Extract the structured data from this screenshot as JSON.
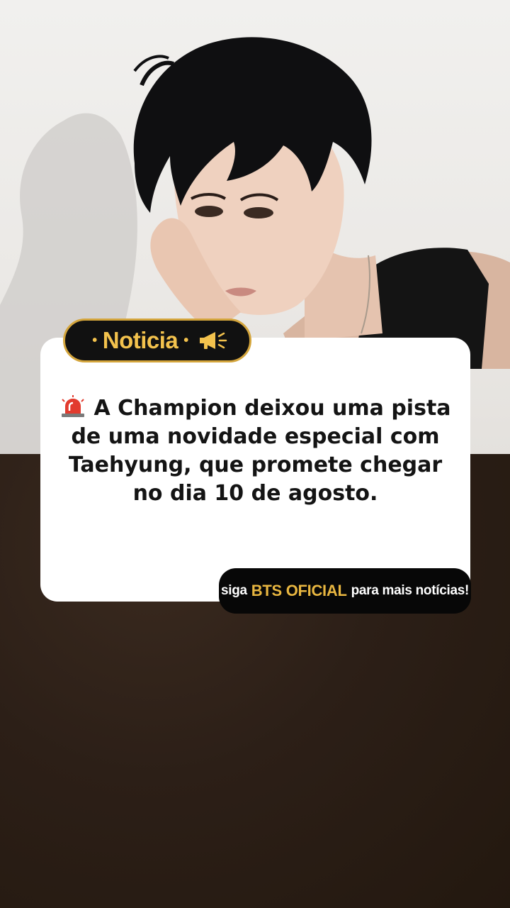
{
  "badge": {
    "label": "Noticia",
    "bullet": "•",
    "icon": "megaphone-icon",
    "text_color": "#f3c24d",
    "border_color": "#d4a53c"
  },
  "headline": {
    "icon": "siren-icon",
    "text": "A Champion deixou uma pista de uma novidade especial com Taehyung, que promete chegar no dia 10 de agosto."
  },
  "follow_banner": {
    "prefix": "siga",
    "brand": "BTS OFICIAL",
    "suffix": "para mais notícias!",
    "brand_color": "#e8b640"
  },
  "colors": {
    "card_background": "#ffffff",
    "bottom_background": "#2a1d16"
  }
}
